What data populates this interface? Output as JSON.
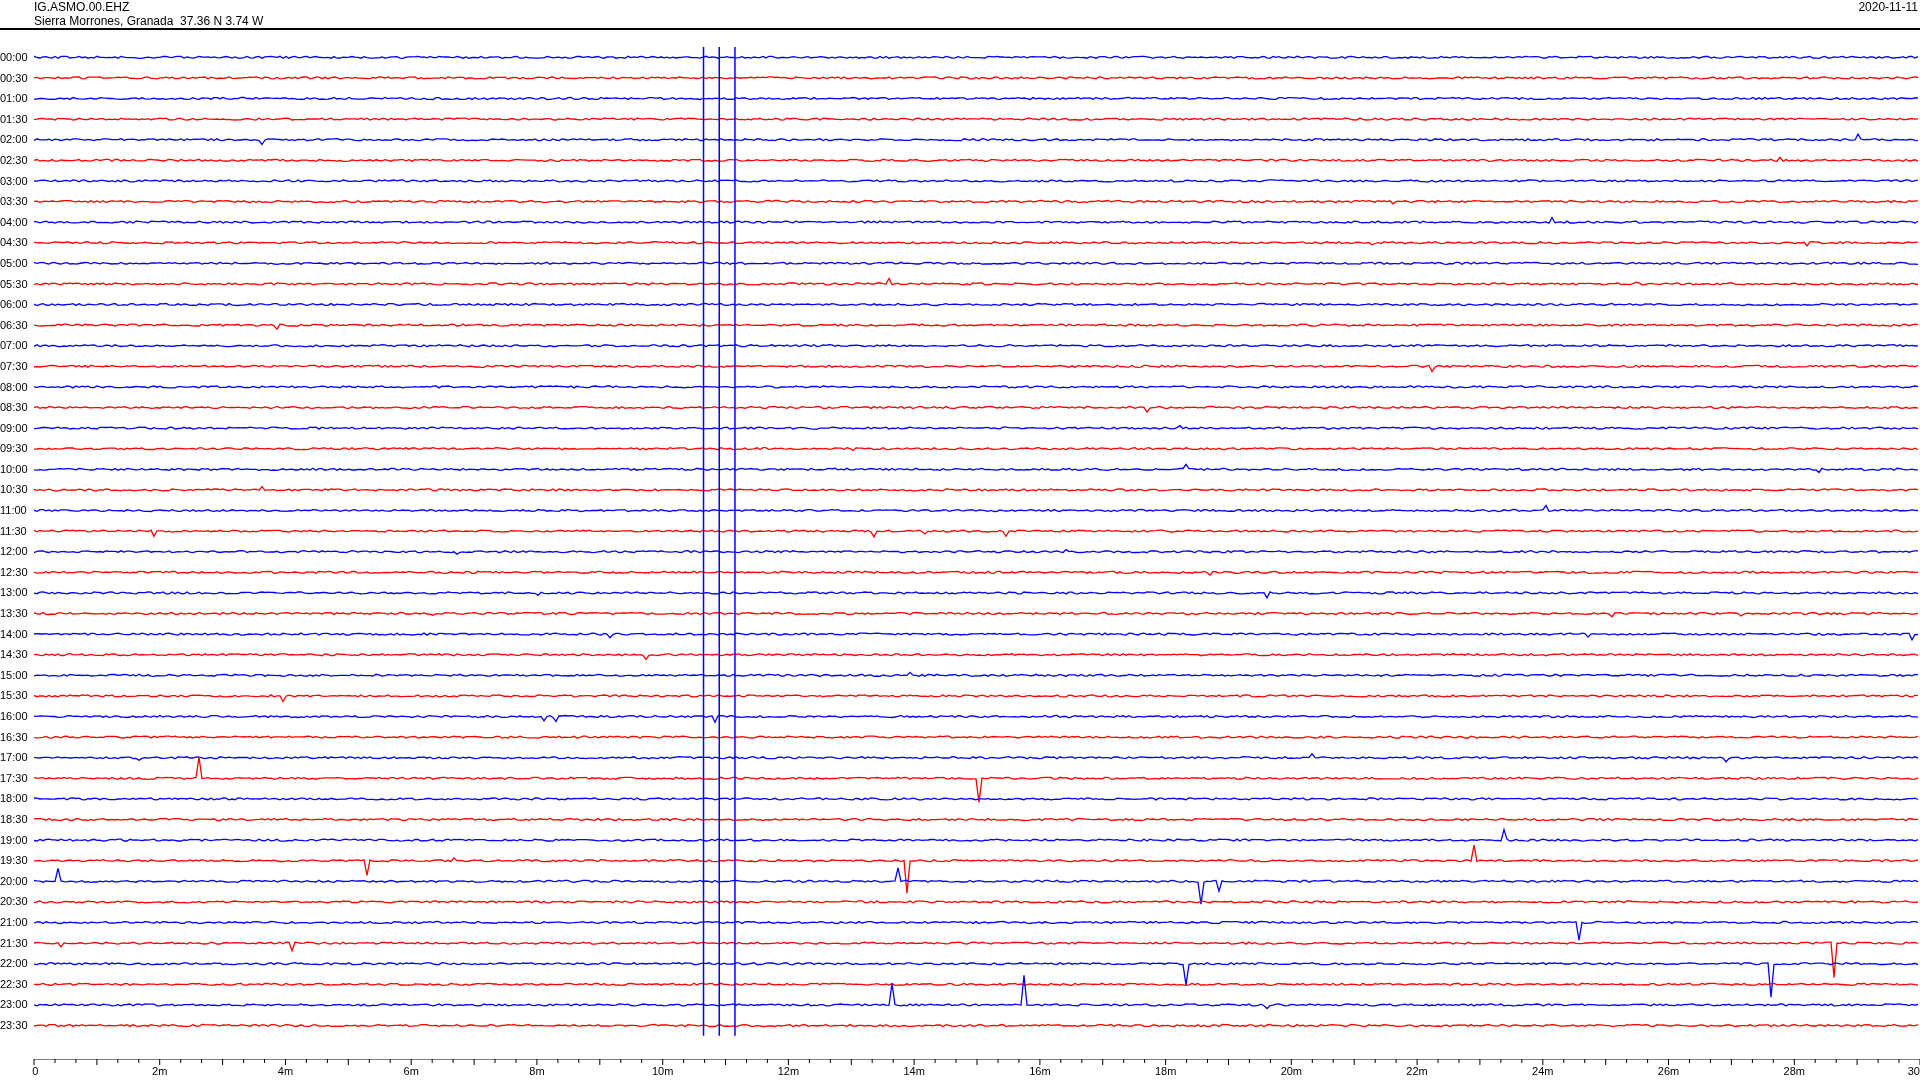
{
  "header": {
    "station": "IG.ASMO.00.EHZ",
    "location": "Sierra Morrones, Granada  37.36 N 3.74 W",
    "date": "2020-11-11"
  },
  "rows": [
    {
      "time": "00:00",
      "color": "#0000ff"
    },
    {
      "time": "00:30",
      "color": "#ff0000"
    },
    {
      "time": "01:00",
      "color": "#0000ff"
    },
    {
      "time": "01:30",
      "color": "#ff0000"
    },
    {
      "time": "02:00",
      "color": "#0000ff"
    },
    {
      "time": "02:30",
      "color": "#ff0000"
    },
    {
      "time": "03:00",
      "color": "#0000ff"
    },
    {
      "time": "03:30",
      "color": "#ff0000"
    },
    {
      "time": "04:00",
      "color": "#0000ff"
    },
    {
      "time": "04:30",
      "color": "#ff0000"
    },
    {
      "time": "05:00",
      "color": "#0000ff"
    },
    {
      "time": "05:30",
      "color": "#ff0000"
    },
    {
      "time": "06:00",
      "color": "#0000ff"
    },
    {
      "time": "06:30",
      "color": "#ff0000"
    },
    {
      "time": "07:00",
      "color": "#0000ff"
    },
    {
      "time": "07:30",
      "color": "#ff0000"
    },
    {
      "time": "08:00",
      "color": "#0000ff"
    },
    {
      "time": "08:30",
      "color": "#ff0000"
    },
    {
      "time": "09:00",
      "color": "#0000ff"
    },
    {
      "time": "09:30",
      "color": "#ff0000"
    },
    {
      "time": "10:00",
      "color": "#0000ff"
    },
    {
      "time": "10:30",
      "color": "#ff0000"
    },
    {
      "time": "11:00",
      "color": "#0000ff"
    },
    {
      "time": "11:30",
      "color": "#ff0000"
    },
    {
      "time": "12:00",
      "color": "#0000ff"
    },
    {
      "time": "12:30",
      "color": "#ff0000"
    },
    {
      "time": "13:00",
      "color": "#0000ff"
    },
    {
      "time": "13:30",
      "color": "#ff0000"
    },
    {
      "time": "14:00",
      "color": "#0000ff"
    },
    {
      "time": "14:30",
      "color": "#ff0000"
    },
    {
      "time": "15:00",
      "color": "#0000ff"
    },
    {
      "time": "15:30",
      "color": "#ff0000"
    },
    {
      "time": "16:00",
      "color": "#0000ff"
    },
    {
      "time": "16:30",
      "color": "#ff0000"
    },
    {
      "time": "17:00",
      "color": "#0000ff"
    },
    {
      "time": "17:30",
      "color": "#ff0000"
    },
    {
      "time": "18:00",
      "color": "#0000ff"
    },
    {
      "time": "18:30",
      "color": "#ff0000"
    },
    {
      "time": "19:00",
      "color": "#0000ff"
    },
    {
      "time": "19:30",
      "color": "#ff0000"
    },
    {
      "time": "20:00",
      "color": "#0000ff"
    },
    {
      "time": "20:30",
      "color": "#ff0000"
    },
    {
      "time": "21:00",
      "color": "#0000ff"
    },
    {
      "time": "21:30",
      "color": "#ff0000"
    },
    {
      "time": "22:00",
      "color": "#0000ff"
    },
    {
      "time": "22:30",
      "color": "#ff0000"
    },
    {
      "time": "23:00",
      "color": "#0000ff"
    },
    {
      "time": "23:30",
      "color": "#ff0000"
    }
  ],
  "x_axis": [
    "0",
    "2m",
    "4m",
    "6m",
    "8m",
    "10m",
    "12m",
    "14m",
    "16m",
    "18m",
    "20m",
    "22m",
    "24m",
    "26m",
    "28m",
    "30"
  ]
}
